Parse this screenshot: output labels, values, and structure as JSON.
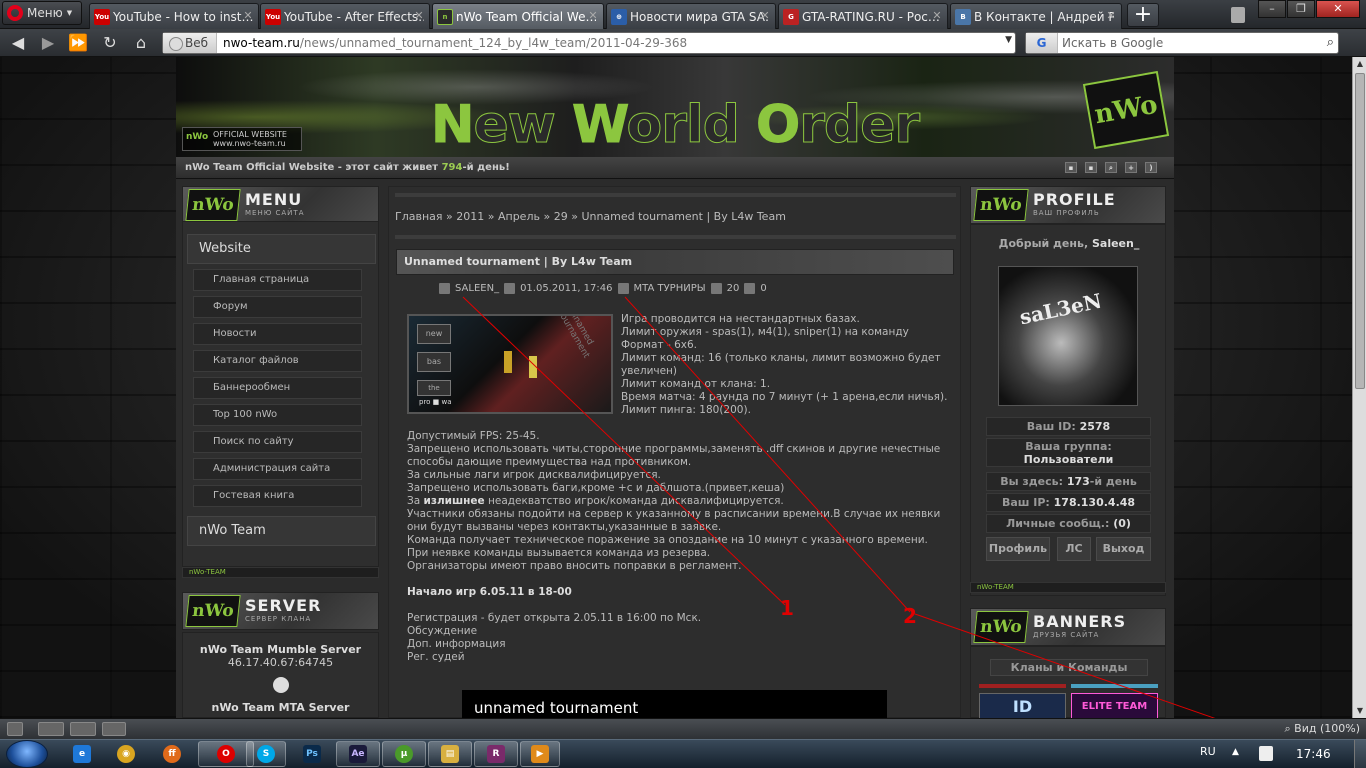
{
  "browser": {
    "menu_label": "Меню",
    "tabs": [
      {
        "label": "YouTube - How to inst…",
        "icon": "youtube-icon",
        "fav_text": "You"
      },
      {
        "label": "YouTube - After Effects…",
        "icon": "youtube-icon",
        "fav_text": "You"
      },
      {
        "label": "nWo Team Official We…",
        "icon": "nwo-favicon-icon",
        "fav_text": "n"
      },
      {
        "label": "Новости мира GTA SA…",
        "icon": "globe-icon",
        "fav_text": "⊕"
      },
      {
        "label": "GTA-RATING.RU - Рос…",
        "icon": "gta-favicon-icon",
        "fav_text": "G"
      },
      {
        "label": "В Контакте | Андрей Р…",
        "icon": "vk-icon",
        "fav_text": "B"
      }
    ],
    "new_tab_label": "+",
    "address": {
      "prefix": "Веб",
      "host": "nwo-team.ru",
      "path": "/news/unnamed_tournament_124_by_l4w_team/2011-04-29-368"
    },
    "search_placeholder": "Искать в Google",
    "search_engine_label": "G",
    "zoom_label": "Вид (100%)"
  },
  "site": {
    "banner_title": {
      "n": "N",
      "ew": "ew ",
      "w": "W",
      "orld": "orld ",
      "o": "O",
      "rder": "rder"
    },
    "banner_official": "OFFICIAL WEBSITE www.nwo-team.ru",
    "banner_logo": "nWo",
    "topline": {
      "prefix": "nWo Team Official Website - этот сайт живет ",
      "days": "794",
      "suffix": "-й день!"
    },
    "menu": {
      "header": "MENU",
      "header_sub": "МЕНЮ САЙТА",
      "section_website": "Website",
      "items": [
        "Главная страница",
        "Форум",
        "Новости",
        "Каталог файлов",
        "Баннерообмен",
        "Top 100 nWo",
        "Поиск по сайту",
        "Администрация сайта",
        "Гостевая книга"
      ],
      "section_team": "nWo Team",
      "footer": "nWo-TEAM"
    },
    "server": {
      "header": "SERVER",
      "header_sub": "СЕРВЕР КЛАНА",
      "mumble_title": "nWo Team Mumble Server",
      "mumble_addr": "46.17.40.67:64745",
      "mta_title": "nWo Team MTA Server"
    },
    "breadcrumb": [
      "Главная",
      "2011",
      "Апрель",
      "29",
      "Unnamed tournament | By L4w Team"
    ],
    "breadcrumb_sep": " » ",
    "post": {
      "title": "Unnamed tournament | By L4w Team",
      "author": "SALEEN_",
      "date": "01.05.2011, 17:46",
      "category": "MTA ТУРНИРЫ",
      "views": "20",
      "comments": "0",
      "right_lines": [
        "Игра проводится на нестандартных базах.",
        "Лимит оружия - spas(1), м4(1), sniper(1) на команду",
        "Формат - 6х6.",
        "Лимит команд: 16 (только кланы, лимит возможно будет увеличен)",
        "Лимит команд от клана: 1.",
        "Время матча: 4 раунда по 7 минут (+ 1 арена,если ничья).",
        "Лимит пинга: 180(200)."
      ],
      "body_lines": [
        "Допустимый FPS: 25-45.",
        "Запрещено использовать читы,сторонние программы,заменять .dff скинов и другие нечестные способы дающие преимущества над противником.",
        "За сильные лаги игрок дисквалифицируется.",
        "Запрещено использовать баги,кроме +c и даблшота.(привет,кеша)"
      ],
      "excess_prefix": "За ",
      "excess_bold": "излишнее",
      "excess_suffix": " неадекватство игрок/команда дисквалифицируется.",
      "body_lines_2": [
        "Участники обязаны подойти на сервер к указанному в расписании времени.В случае их неявки они будут вызваны через контакты,указанные в заявке.",
        "Команда получает техническое поражение за опоздание на 10 минут с указанного времени.",
        "При неявке команды вызывается команда из резерва.",
        "Организаторы имеют право вносить поправки в регламент."
      ],
      "start_bold": "Начало игр 6.05.11 в 18-00",
      "links": [
        "Регистрация - будет открыта 2.05.11 в 16:00 по Мск.",
        "Обсуждение",
        "Доп. информация",
        "Рег. судей"
      ],
      "video_title": "unnamed tournament",
      "thumb_watermark": "Unnamed tournament",
      "thumb_labels": [
        "new",
        "bas",
        "the",
        "pro",
        "wa"
      ]
    },
    "profile": {
      "header": "PROFILE",
      "header_sub": "ВАШ ПРОФИЛЬ",
      "greeting": "Добрый день, ",
      "username": "Saleen_",
      "avatar_tag": "saL3eN",
      "id_label": "Ваш ID: ",
      "id_value": "2578",
      "group_label": "Ваша группа:",
      "group_value": "Пользователи",
      "here_label": "Вы здесь: ",
      "here_value": "173",
      "here_suffix": "-й день",
      "ip_label": "Ваш IP: ",
      "ip_value": "178.130.4.48",
      "msgs_label": "Личные сообщ.: ",
      "msgs_value": "(0)",
      "btn_profile": "Профиль",
      "btn_ls": "ЛС",
      "btn_exit": "Выход",
      "footer": "nWo-TEAM"
    },
    "banners": {
      "header": "BANNERS",
      "header_sub": "ДРУЗЬЯ САЙТА",
      "clans_title": "Кланы и Команды",
      "banner_1": "ID",
      "banner_2": "ELITE TEAM"
    }
  },
  "annotations": {
    "label_1": "1",
    "label_2": "2",
    "color": "#e00000"
  },
  "taskbar": {
    "lang": "RU",
    "clock": "17:46",
    "apps": [
      {
        "icon": "ie-icon",
        "glyph": "e"
      },
      {
        "icon": "chrome-icon",
        "glyph": "◉"
      },
      {
        "icon": "firefox-icon",
        "glyph": "ff"
      },
      {
        "icon": "opera-icon",
        "glyph": "O"
      },
      {
        "icon": "skype-icon",
        "glyph": "S"
      },
      {
        "icon": "photoshop-icon",
        "glyph": "Ps"
      },
      {
        "icon": "after-effects-icon",
        "glyph": "Ae"
      },
      {
        "icon": "utorrent-icon",
        "glyph": "µ"
      },
      {
        "icon": "explorer-icon",
        "glyph": "▤"
      },
      {
        "icon": "winrar-icon",
        "glyph": "R"
      },
      {
        "icon": "media-player-icon",
        "glyph": "▶"
      }
    ]
  }
}
